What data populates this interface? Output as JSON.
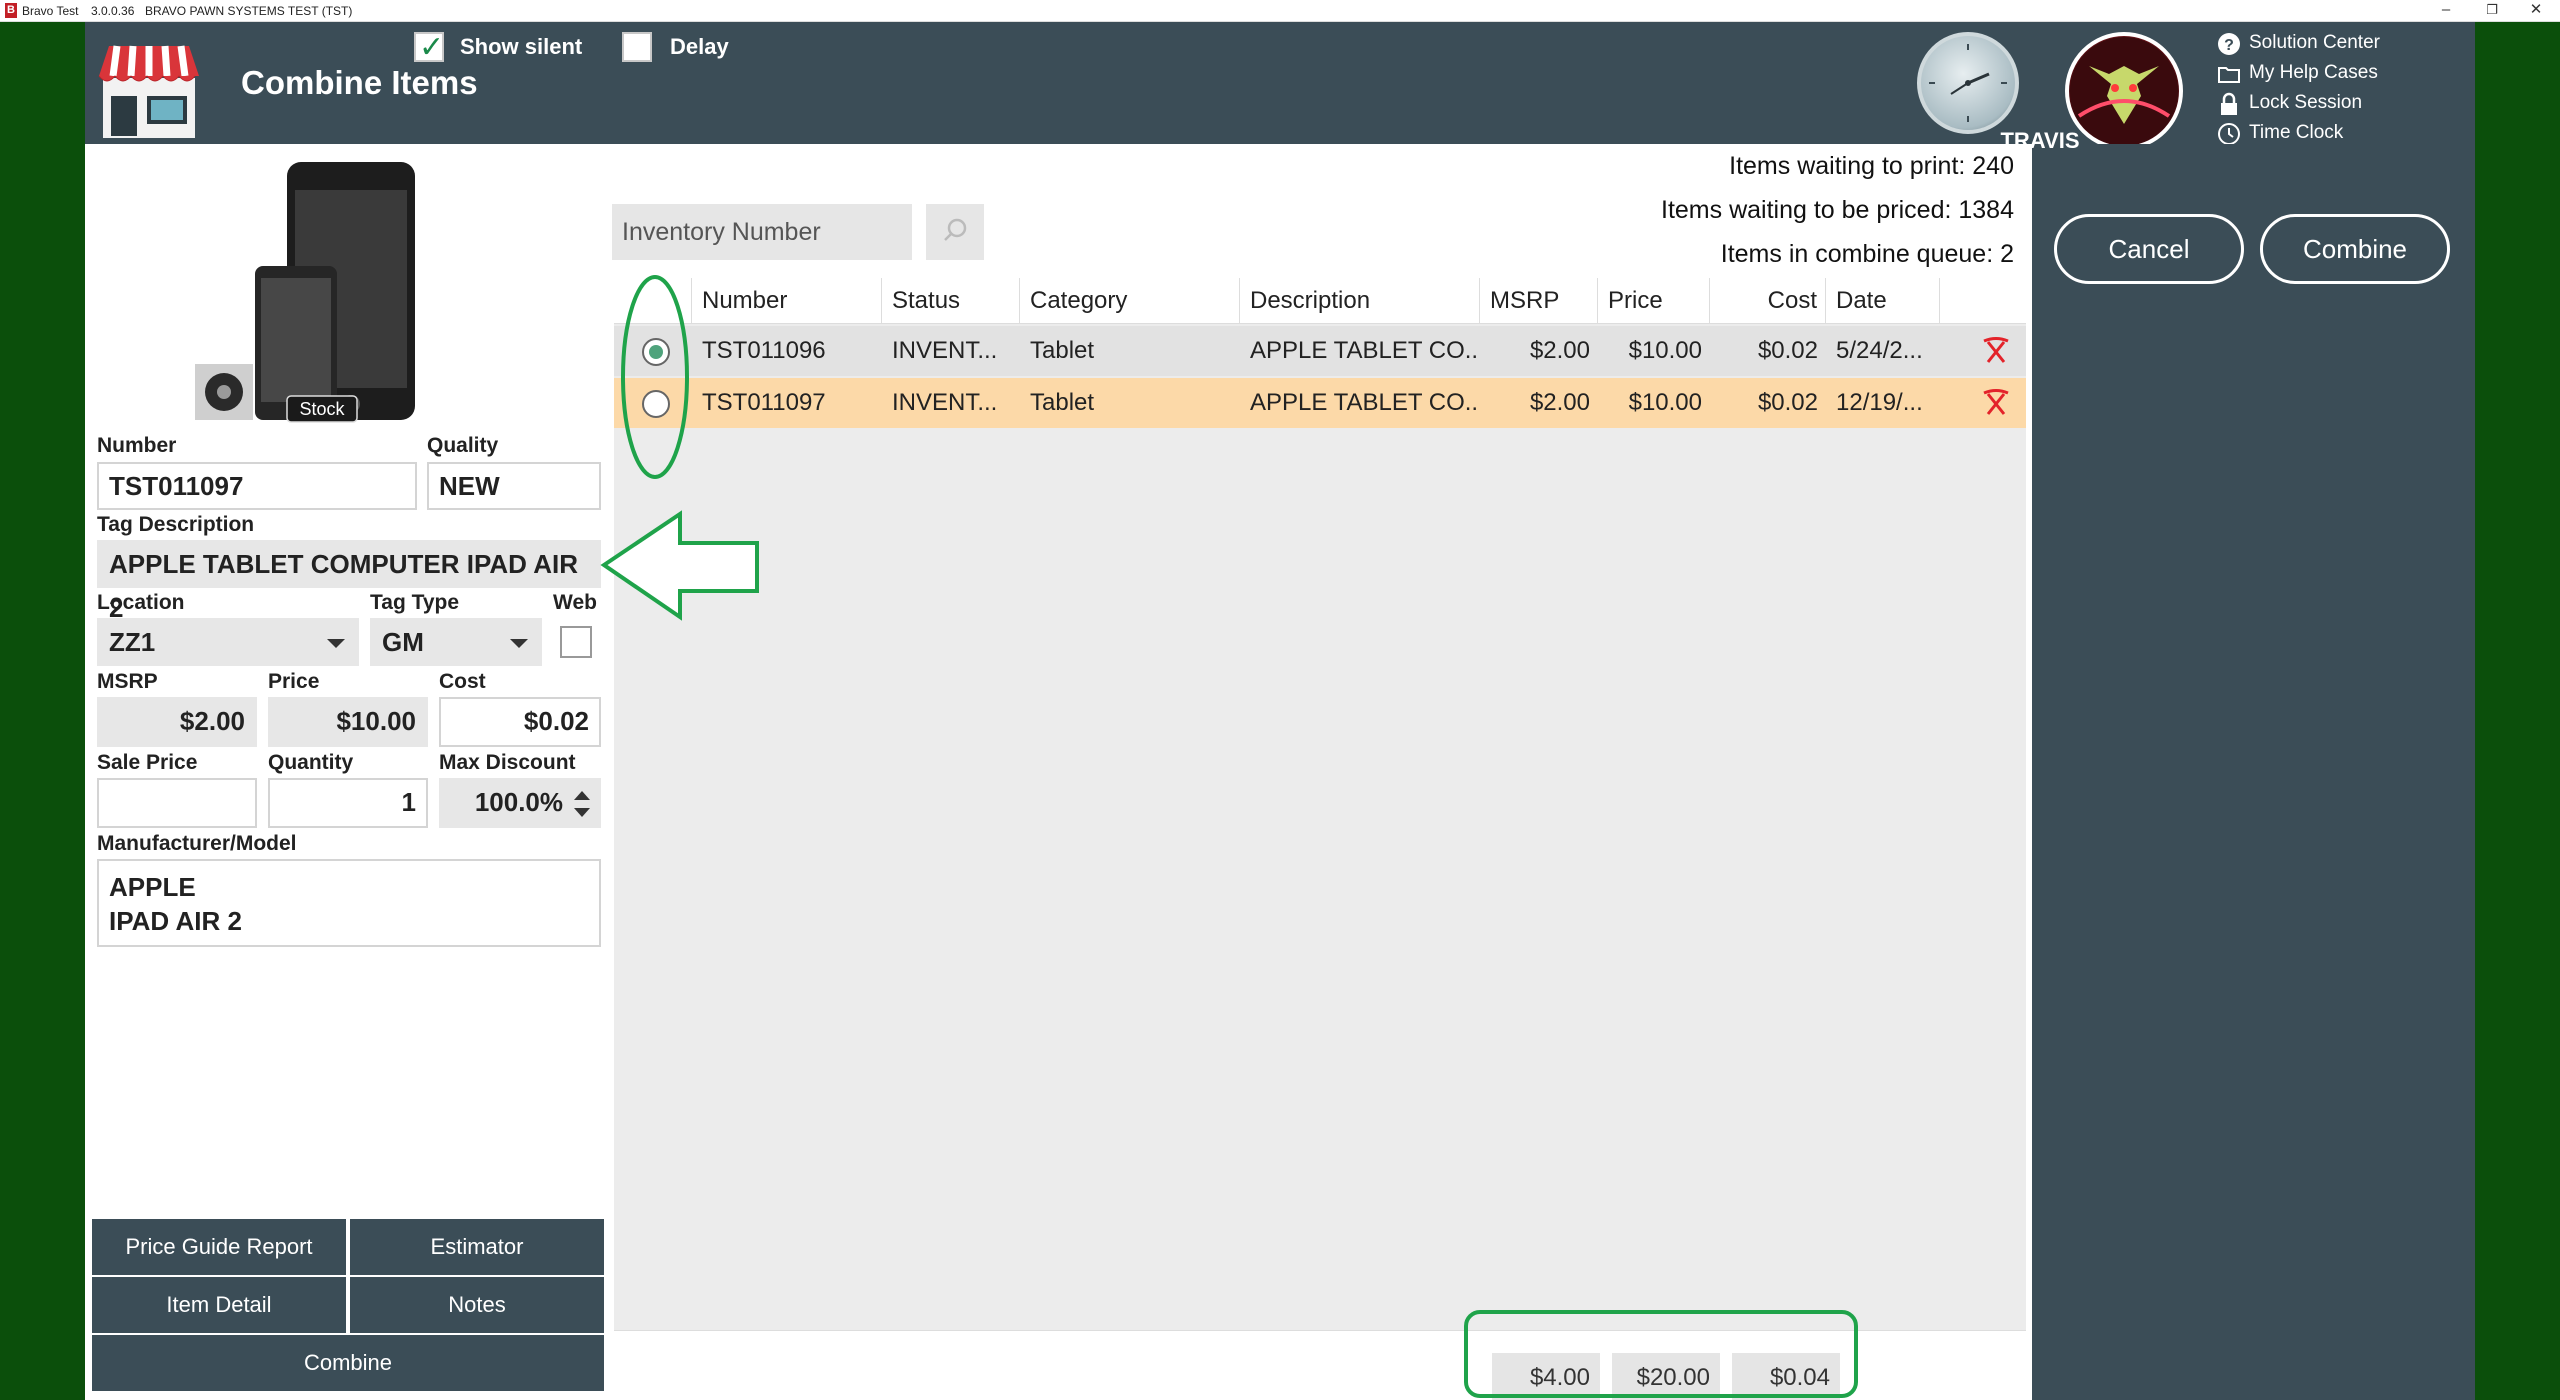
{
  "titlebar": {
    "logo": "B",
    "app_name": "Bravo Test",
    "version": "3.0.0.36",
    "system": "BRAVO PAWN SYSTEMS TEST (TST)",
    "minimize": "–",
    "restore": "❐",
    "close": "✕"
  },
  "header": {
    "title": "Combine Items",
    "show_silent_label": "Show silent",
    "show_silent_checked": true,
    "delay_label": "Delay",
    "delay_checked": false,
    "user_name": "TRAVIS",
    "links": [
      {
        "label": "Solution Center",
        "icon": "question-circle-icon"
      },
      {
        "label": "My Help Cases",
        "icon": "folder-icon"
      },
      {
        "label": "Lock Session",
        "icon": "lock-icon"
      },
      {
        "label": "Time Clock",
        "icon": "clock-icon"
      }
    ]
  },
  "item": {
    "stock_badge": "Stock",
    "number_label": "Number",
    "number": "TST011097",
    "quality_label": "Quality",
    "quality": "NEW",
    "tag_description_label": "Tag Description",
    "tag_description": "APPLE TABLET COMPUTER IPAD AIR 2",
    "location_label": "Location",
    "location": "ZZ1",
    "tag_type_label": "Tag Type",
    "tag_type": "GM",
    "web_label": "Web",
    "msrp_label": "MSRP",
    "msrp": "$2.00",
    "price_label": "Price",
    "price": "$10.00",
    "cost_label": "Cost",
    "cost": "$0.02",
    "sale_price_label": "Sale Price",
    "sale_price": "",
    "quantity_label": "Quantity",
    "quantity": "1",
    "max_discount_label": "Max Discount",
    "max_discount": "100.0%",
    "manufacturer_label": "Manufacturer/Model",
    "manufacturer": "APPLE",
    "model": "IPAD AIR 2"
  },
  "left_buttons": {
    "price_guide": "Price Guide Report",
    "estimator": "Estimator",
    "item_detail": "Item Detail",
    "notes": "Notes",
    "combine": "Combine"
  },
  "search": {
    "placeholder": "Inventory Number"
  },
  "stats": {
    "waiting_print": "Items waiting to print: 240",
    "waiting_priced": "Items waiting to be priced: 1384",
    "combine_queue": "Items in combine queue: 2"
  },
  "grid": {
    "columns": [
      "Number",
      "Status",
      "Category",
      "Description",
      "MSRP",
      "Price",
      "Cost",
      "Date"
    ],
    "rows": [
      {
        "number": "TST011096",
        "status": "INVENT...",
        "category": "Tablet",
        "description": "APPLE TABLET CO...",
        "msrp": "$2.00",
        "price": "$10.00",
        "cost": "$0.02",
        "date": "5/24/2...",
        "selected": true
      },
      {
        "number": "TST011097",
        "status": "INVENT...",
        "category": "Tablet",
        "description": "APPLE TABLET CO...",
        "msrp": "$2.00",
        "price": "$10.00",
        "cost": "$0.02",
        "date": "12/19/...",
        "selected": false
      }
    ],
    "totals": {
      "msrp": "$4.00",
      "price": "$20.00",
      "cost": "$0.04"
    }
  },
  "actions": {
    "cancel": "Cancel",
    "combine": "Combine"
  },
  "colors": {
    "header_bg": "#3b4d57",
    "desktop_bg": "#0b4f0b",
    "row_highlight": "#fcd9a8",
    "row_selected": "#e2e2e2",
    "annotation": "#1fa34a",
    "delete_red": "#e3232a"
  }
}
